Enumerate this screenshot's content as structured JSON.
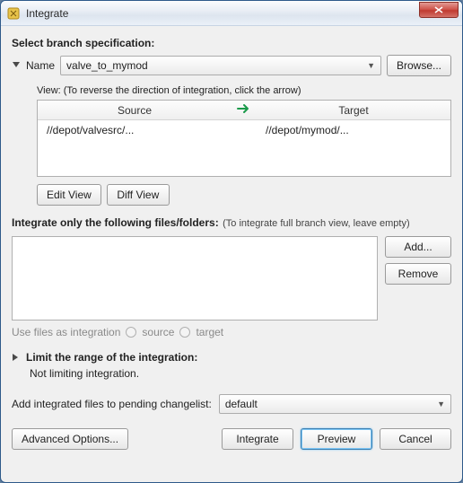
{
  "window": {
    "title": "Integrate"
  },
  "section_branch": "Select branch specification:",
  "name_label": "Name",
  "branch_combo": "valve_to_mymod",
  "browse_label": "Browse...",
  "view_hint": "View: (To reverse the direction of integration, click the arrow)",
  "cols": {
    "source": "Source",
    "target": "Target"
  },
  "row": {
    "source": "//depot/valvesrc/...",
    "target": "//depot/mymod/..."
  },
  "edit_view": "Edit View",
  "diff_view": "Diff View",
  "integrate_only": "Integrate only the following files/folders:",
  "integrate_only_hint": "(To integrate full branch view, leave empty)",
  "add_label": "Add...",
  "remove_label": "Remove",
  "use_files_label": "Use files as integration",
  "radio_source": "source",
  "radio_target": "target",
  "limit_label": "Limit the range of the integration:",
  "not_limiting": "Not limiting integration.",
  "changelist_label": "Add integrated files to pending changelist:",
  "changelist_value": "default",
  "advanced_label": "Advanced Options...",
  "integrate_label": "Integrate",
  "preview_label": "Preview",
  "cancel_label": "Cancel"
}
